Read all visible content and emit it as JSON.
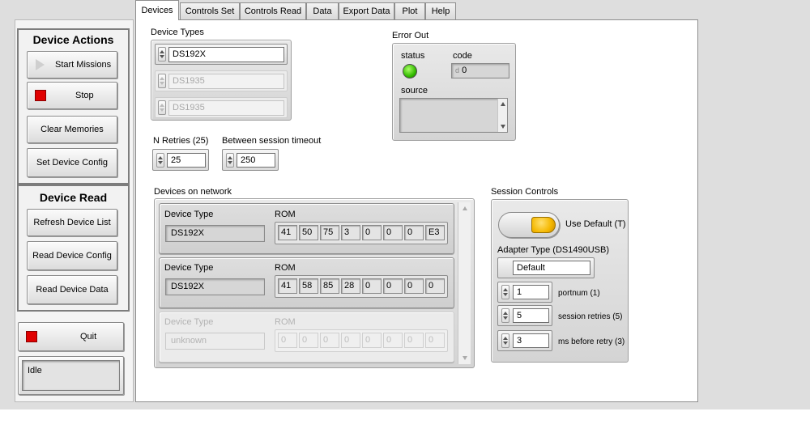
{
  "left": {
    "device_actions": {
      "title": "Device Actions",
      "start_missions": "Start Missions",
      "stop": "Stop",
      "clear_memories": "Clear Memories",
      "set_device_config": "Set Device Config"
    },
    "device_read": {
      "title": "Device Read",
      "refresh_device_list": "Refresh Device List",
      "read_device_config": "Read Device Config",
      "read_device_data": "Read Device Data"
    },
    "quit": "Quit",
    "status": "Idle"
  },
  "tabs": [
    "Devices",
    "Controls Set",
    "Controls Read",
    "Data",
    "Export Data",
    "Plot",
    "Help"
  ],
  "devices_tab": {
    "device_types_label": "Device Types",
    "device_types": [
      "DS192X",
      "DS1935",
      "DS1935"
    ],
    "n_retries_label": "N Retries (25)",
    "n_retries": "25",
    "between_session_timeout_label": "Between session timeout",
    "between_session_timeout": "250",
    "error_out": {
      "label": "Error Out",
      "status_label": "status",
      "code_label": "code",
      "code_prefix": "d",
      "code": "0",
      "source_label": "source",
      "status_color": "#33bb00"
    },
    "devices_on_network": {
      "label": "Devices on network",
      "device_type_label": "Device Type",
      "rom_label": "ROM",
      "devices": [
        {
          "type": "DS192X",
          "rom": [
            "41",
            "50",
            "75",
            "3",
            "0",
            "0",
            "0",
            "E3"
          ]
        },
        {
          "type": "DS192X",
          "rom": [
            "41",
            "58",
            "85",
            "28",
            "0",
            "0",
            "0",
            "0"
          ]
        },
        {
          "type": "unknown",
          "rom": [
            "0",
            "0",
            "0",
            "0",
            "0",
            "0",
            "0",
            "0"
          ]
        }
      ]
    },
    "session_controls": {
      "label": "Session Controls",
      "use_default_label": "Use Default (T)",
      "use_default_color": "#f5b800",
      "adapter_type_label": "Adapter Type (DS1490USB)",
      "adapter_type": "Default",
      "portnum": "1",
      "portnum_label": "portnum (1)",
      "session_retries": "5",
      "session_retries_label": "session retries (5)",
      "ms_before_retry": "3",
      "ms_before_retry_label": "ms before retry (3)"
    }
  },
  "colors": {
    "stop_red": "#e00000",
    "led_green": "#33bb00",
    "toggle_yellow": "#f5b800"
  }
}
